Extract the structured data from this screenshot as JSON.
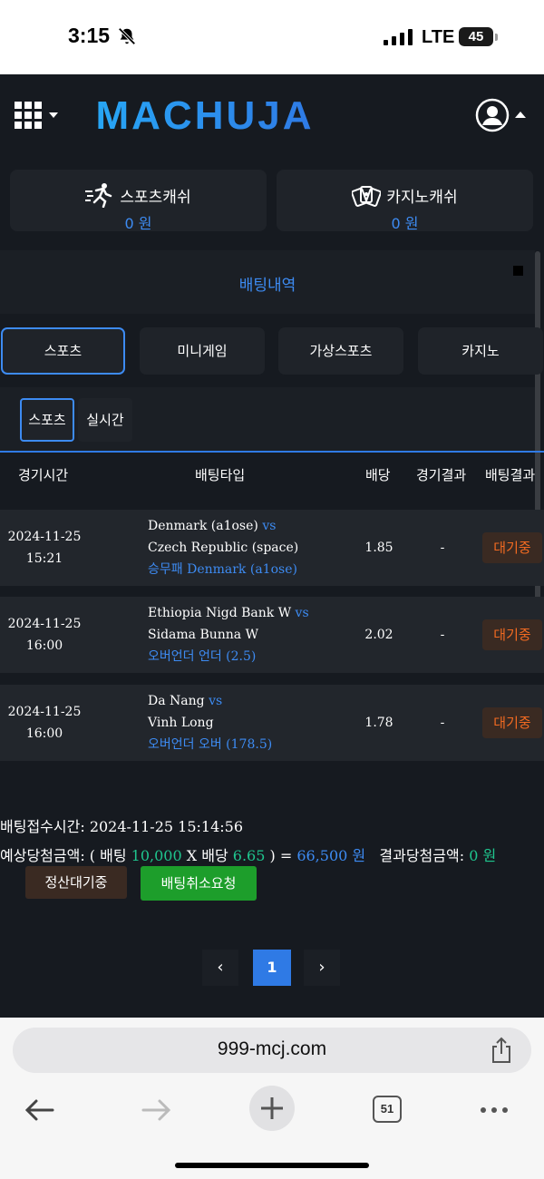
{
  "status_bar": {
    "time": "3:15",
    "carrier": "LTE",
    "battery": "45"
  },
  "header": {
    "logo_text": "MACHUJA"
  },
  "cash": {
    "sports": {
      "label": "스포츠캐쉬",
      "amount": "0 원"
    },
    "casino": {
      "label": "카지노캐쉬",
      "amount": "0 원"
    }
  },
  "section_title": "배팅내역",
  "category_tabs": [
    {
      "label": "스포츠",
      "active": true
    },
    {
      "label": "미니게임",
      "active": false
    },
    {
      "label": "가상스포츠",
      "active": false
    },
    {
      "label": "카지노",
      "active": false
    }
  ],
  "sub_tabs": [
    {
      "label": "스포츠",
      "active": true
    },
    {
      "label": "실시간",
      "active": false
    }
  ],
  "table": {
    "headers": [
      "경기시간",
      "배팅타입",
      "배당",
      "경기결과",
      "배팅결과"
    ],
    "rows": [
      {
        "date": "2024-11-25",
        "time": "15:21",
        "home": "Denmark (a1ose)",
        "vs": "vs",
        "away": "Czech Republic (space)",
        "pick": "승무패 Denmark (a1ose)",
        "odds": "1.85",
        "result": "-",
        "status": "대기중"
      },
      {
        "date": "2024-11-25",
        "time": "16:00",
        "home": "Ethiopia Nigd Bank W",
        "vs": "vs",
        "away": "Sidama Bunna W",
        "pick": "오버언더 언더 (2.5)",
        "odds": "2.02",
        "result": "-",
        "status": "대기중"
      },
      {
        "date": "2024-11-25",
        "time": "16:00",
        "home": "Da Nang",
        "vs": "vs",
        "away": "Vinh Long",
        "pick": "오버언더 오버 (178.5)",
        "odds": "1.78",
        "result": "-",
        "status": "대기중"
      }
    ]
  },
  "summary": {
    "time_label": "배팅접수시간:",
    "time_value": "2024-11-25 15:14:56",
    "expected_label": "예상당첨금액: ( 배팅",
    "stake": "10,000",
    "x_label": "X 배당",
    "odds": "6.65",
    "close_eq": ") =",
    "expected_amount": "66,500 원",
    "result_label": "결과당첨금액:",
    "result_amount": "0 원",
    "pending_button": "정산대기중",
    "cancel_button": "배팅취소요청"
  },
  "pagination": {
    "prev": "‹",
    "current": "1",
    "next": "›"
  },
  "browser": {
    "url": "999-mcj.com",
    "tabs_count": "51"
  },
  "colors": {
    "accent_blue": "#3d8bf2",
    "status_orange": "#f26a21",
    "green": "#1fc58e",
    "cancel_green": "#1d9e2b",
    "bg_dark": "#161a20"
  },
  "icons": [
    "bell-slash-icon",
    "signal-icon",
    "grid-menu-icon",
    "user-circle-icon",
    "runner-icon",
    "cards-icon",
    "share-icon",
    "back-arrow-icon",
    "forward-arrow-icon",
    "plus-icon",
    "tabs-icon",
    "more-icon"
  ]
}
